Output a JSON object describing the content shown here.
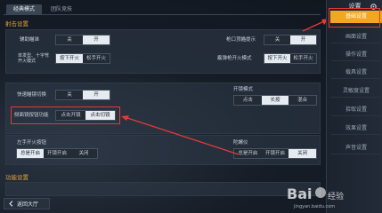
{
  "mode_tabs": [
    "经典模式",
    "团队竞技"
  ],
  "sections": {
    "fire": "射击设置",
    "function": "功能设置"
  },
  "rows": {
    "aim_assist": {
      "label": "辅助瞄准",
      "options": [
        "关",
        "开"
      ],
      "selected": 1
    },
    "ads_hint": {
      "label": "枪口顶瞄提示",
      "options": [
        "关",
        "开"
      ],
      "selected": 1
    },
    "single_fire": {
      "label": "单发型、十字弩\n开火模式",
      "options": [
        "按下开火",
        "松手开火"
      ],
      "selected": 0
    },
    "sniper_fire": {
      "label": "霰弹枪开火模式",
      "options": [
        "按下开火",
        "松手开火"
      ],
      "selected": 0
    },
    "quick_scope": {
      "label": "快速瞄镜切换",
      "options": [
        "关",
        "开"
      ],
      "selected": 1
    },
    "scope_mode": {
      "label": "开镜模式",
      "options": [
        "点击",
        "长按",
        "混合"
      ],
      "selected": 1
    },
    "side_scope": {
      "label": "侧面镜按钮功能",
      "options": [
        "点击开镜",
        "点击切镜"
      ],
      "selected": 1
    },
    "left_fire": {
      "label": "左手开火按钮",
      "options": [
        "总是开启",
        "开镜开启",
        "关闭"
      ],
      "selected": 0
    },
    "gyroscope": {
      "label": "陀螺仪",
      "options": [
        "总是开启",
        "开镜开启",
        "关闭"
      ],
      "selected": 2
    }
  },
  "sidebar": {
    "title": "设置",
    "items": [
      "基础设置",
      "画面设置",
      "操作设置",
      "载具设置",
      "灵敏度设置",
      "拾取设置",
      "效果设置",
      "声音设置"
    ],
    "active": 0
  },
  "back_button": "返回大厅",
  "watermark": {
    "brand": "Bai",
    "brand2": "经验",
    "url": "jingyan.baidu.com"
  },
  "colors": {
    "accent": "#f5a524",
    "highlight_box": "#e53935",
    "selected_segment": "#e6ebf1"
  }
}
